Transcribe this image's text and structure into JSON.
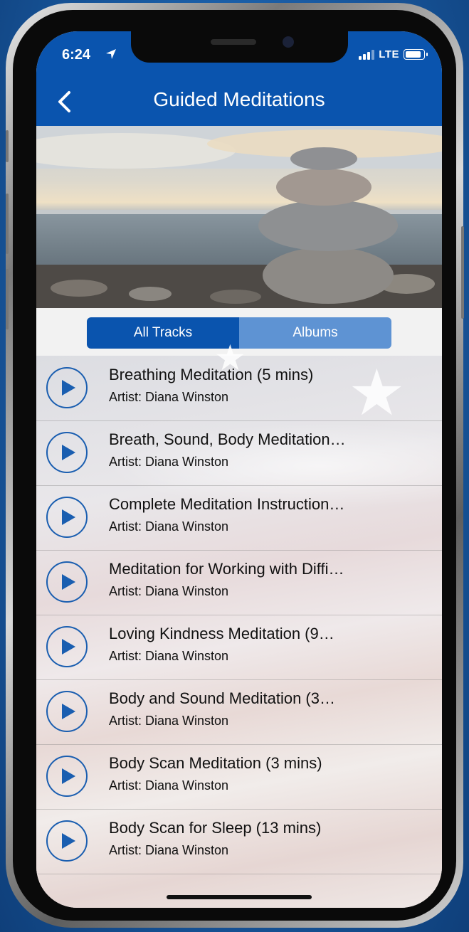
{
  "status_bar": {
    "time": "6:24",
    "network": "LTE"
  },
  "header": {
    "title": "Guided Meditations"
  },
  "segments": {
    "all_tracks": "All Tracks",
    "albums": "Albums",
    "selected": "All Tracks"
  },
  "tracks": [
    {
      "title": "Breathing Meditation (5 mins)",
      "artist": "Artist: Diana Winston"
    },
    {
      "title": "Breath, Sound, Body Meditation…",
      "artist": "Artist: Diana Winston"
    },
    {
      "title": "Complete Meditation Instruction…",
      "artist": "Artist: Diana Winston"
    },
    {
      "title": "Meditation for Working with Diffi…",
      "artist": "Artist: Diana Winston"
    },
    {
      "title": "Loving Kindness Meditation (9…",
      "artist": "Artist: Diana Winston"
    },
    {
      "title": "Body and Sound Meditation (3…",
      "artist": "Artist: Diana Winston"
    },
    {
      "title": "Body Scan Meditation (3 mins)",
      "artist": "Artist: Diana Winston"
    },
    {
      "title": "Body Scan for Sleep (13 mins)",
      "artist": "Artist: Diana Winston"
    }
  ],
  "colors": {
    "header_blue": "#0a54ae",
    "segment_inactive": "#5e93d3",
    "play_blue": "#1a5eb0"
  },
  "icons": {
    "back": "chevron-left-icon",
    "play": "play-icon",
    "location": "location-arrow-icon",
    "signal": "signal-bars-icon",
    "battery": "battery-icon"
  }
}
